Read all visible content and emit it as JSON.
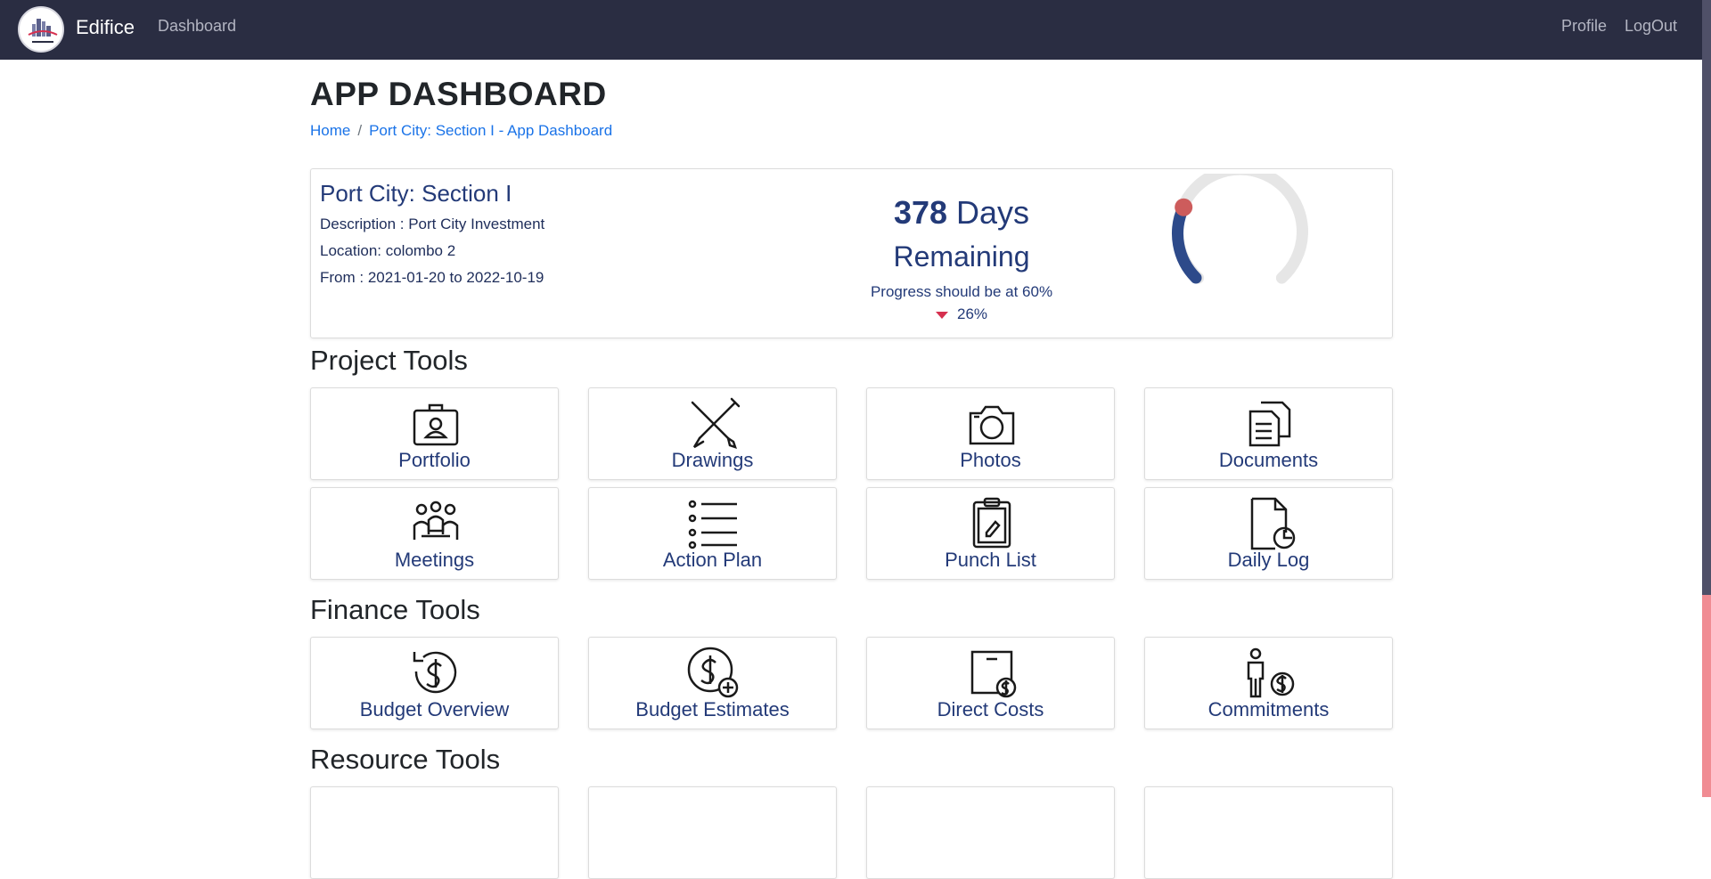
{
  "nav": {
    "brand": "Edifice",
    "dashboard": "Dashboard",
    "profile": "Profile",
    "logout": "LogOut"
  },
  "page": {
    "title": "APP DASHBOARD"
  },
  "breadcrumb": {
    "home": "Home",
    "separator": "/",
    "current": "Port City: Section I - App Dashboard"
  },
  "project": {
    "name": "Port City: Section I",
    "description": "Description : Port City Investment",
    "location": "Location: colombo 2",
    "dates": "From : 2021-01-20 to 2022-10-19",
    "days_number": "378",
    "days_label": "Days",
    "remaining": "Remaining",
    "progress_text": "Progress should be at 60%",
    "progress_actual": "26%",
    "progress_fraction": 0.26
  },
  "sections": {
    "project_tools": "Project Tools",
    "finance_tools": "Finance Tools",
    "resource_tools": "Resource Tools"
  },
  "tiles": {
    "portfolio": "Portfolio",
    "drawings": "Drawings",
    "photos": "Photos",
    "documents": "Documents",
    "meetings": "Meetings",
    "action_plan": "Action Plan",
    "punch_list": "Punch List",
    "daily_log": "Daily Log",
    "budget_overview": "Budget Overview",
    "budget_estimates": "Budget Estimates",
    "direct_costs": "Direct Costs",
    "commitments": "Commitments"
  },
  "colors": {
    "navbar": "#2a2d42",
    "accent_blue": "#233a78",
    "link": "#1a73e8",
    "gauge_marker": "#cd5c5c",
    "gauge_track": "#e6e6e6",
    "down_arrow": "#d6304f"
  }
}
